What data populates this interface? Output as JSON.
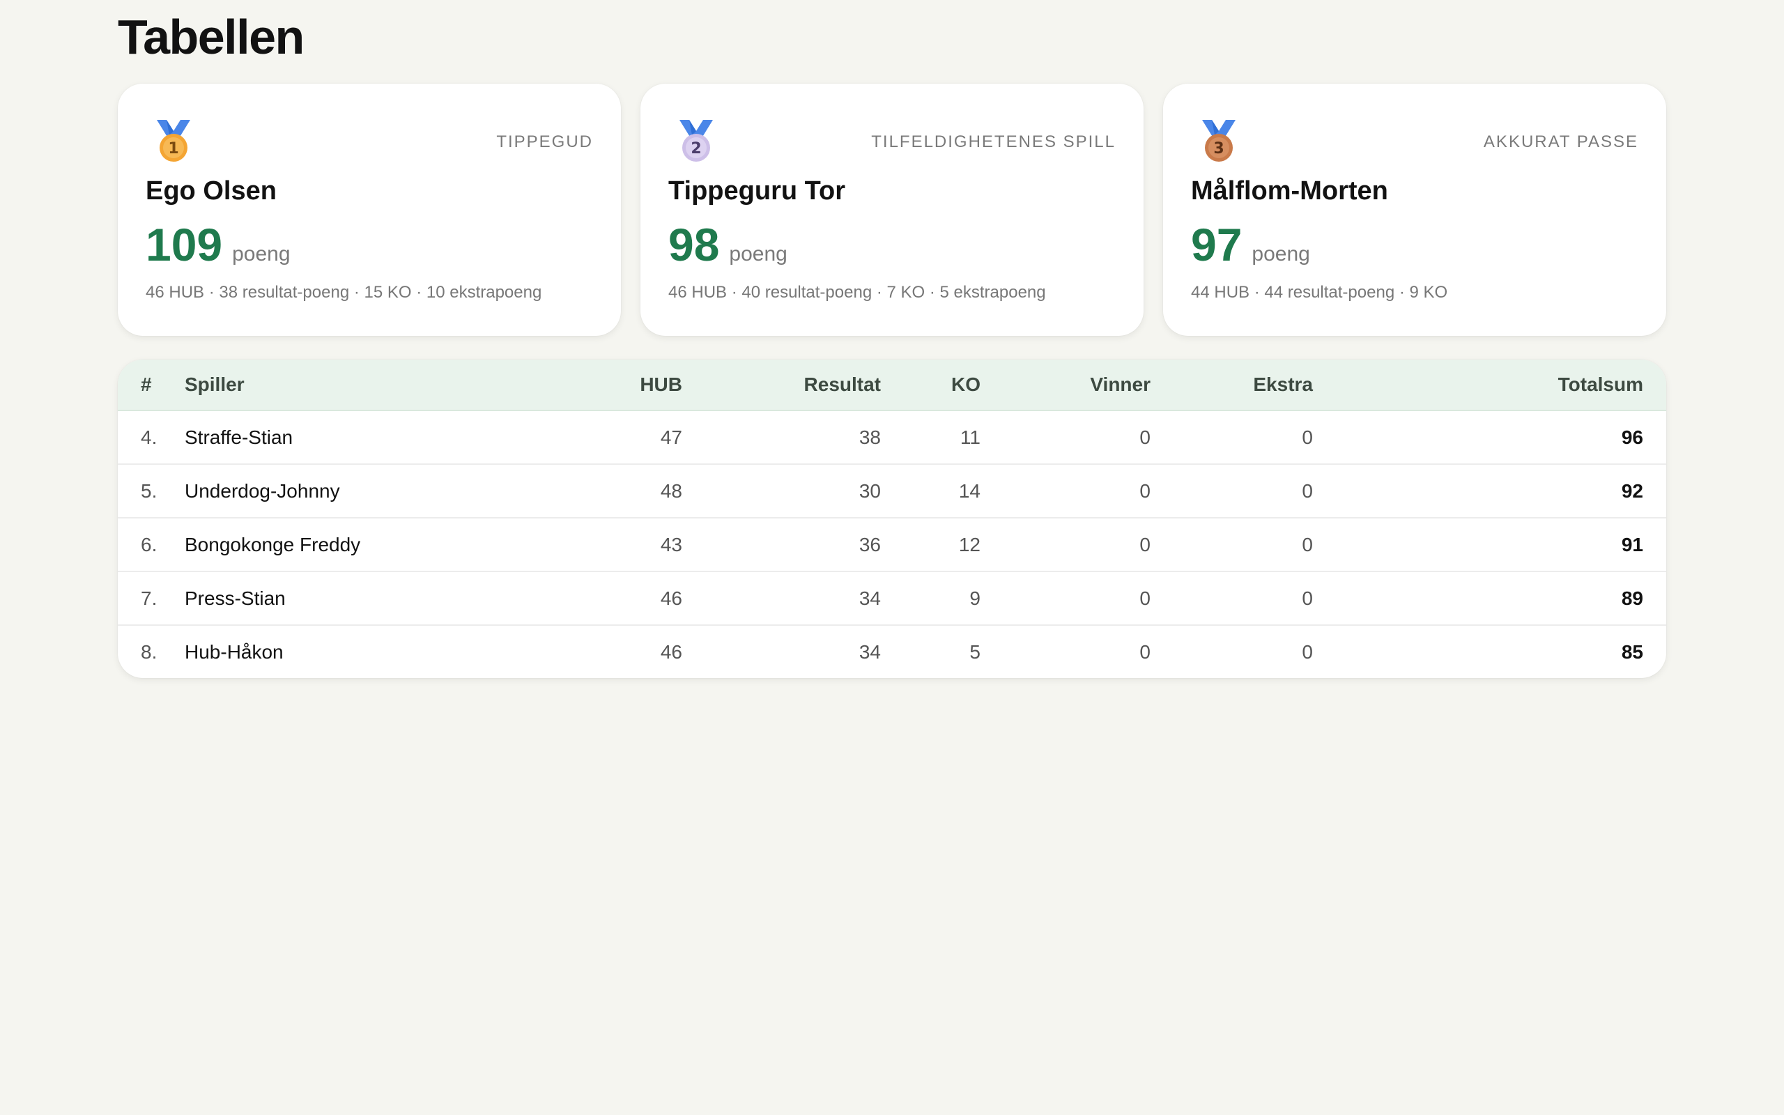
{
  "page": {
    "title": "Tabellen"
  },
  "podium": [
    {
      "medal": "1",
      "medal_icon": "gold-medal-icon",
      "medal_color": "#f4a533",
      "tag": "TIPPEGUD",
      "name": "Ego Olsen",
      "score": "109",
      "unit": "poeng",
      "detail": "46 HUB · 38 resultat-poeng · 15 KO · 10 ekstrapoeng"
    },
    {
      "medal": "2",
      "medal_icon": "silver-medal-icon",
      "medal_color": "#cdbfe8",
      "tag": "TILFELDIGHETENES SPILL",
      "name": "Tippeguru Tor",
      "score": "98",
      "unit": "poeng",
      "detail": "46 HUB · 40 resultat-poeng · 7 KO · 5 ekstrapoeng"
    },
    {
      "medal": "3",
      "medal_icon": "bronze-medal-icon",
      "medal_color": "#c97a4a",
      "tag": "AKKURAT PASSE",
      "name": "Målflom-Morten",
      "score": "97",
      "unit": "poeng",
      "detail": "44 HUB · 44 resultat-poeng · 9 KO"
    }
  ],
  "table": {
    "headers": {
      "rank": "#",
      "player": "Spiller",
      "hub": "HUB",
      "result": "Resultat",
      "ko": "KO",
      "winner": "Vinner",
      "extra": "Ekstra",
      "total": "Totalsum"
    },
    "rows": [
      {
        "rank": "4.",
        "player": "Straffe-Stian",
        "hub": "47",
        "result": "38",
        "ko": "11",
        "winner": "0",
        "extra": "0",
        "total": "96"
      },
      {
        "rank": "5.",
        "player": "Underdog-Johnny",
        "hub": "48",
        "result": "30",
        "ko": "14",
        "winner": "0",
        "extra": "0",
        "total": "92"
      },
      {
        "rank": "6.",
        "player": "Bongokonge Freddy",
        "hub": "43",
        "result": "36",
        "ko": "12",
        "winner": "0",
        "extra": "0",
        "total": "91"
      },
      {
        "rank": "7.",
        "player": "Press-Stian",
        "hub": "46",
        "result": "34",
        "ko": "9",
        "winner": "0",
        "extra": "0",
        "total": "89"
      },
      {
        "rank": "8.",
        "player": "Hub-Håkon",
        "hub": "46",
        "result": "34",
        "ko": "5",
        "winner": "0",
        "extra": "0",
        "total": "85"
      }
    ]
  },
  "colors": {
    "accent": "#1f7a4d",
    "ribbon": "#4a86e8",
    "header_bg": "#e9f3ec",
    "page_bg": "#f5f5f0"
  }
}
